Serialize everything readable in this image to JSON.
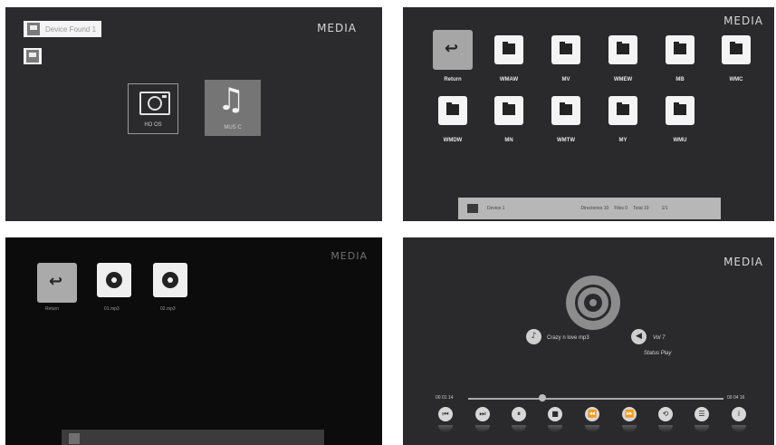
{
  "panel1": {
    "title": "MEDIA",
    "device_found": "Device Found 1",
    "tiles": [
      {
        "label": "HO OS"
      },
      {
        "label": "MUS C"
      }
    ]
  },
  "panel2": {
    "title": "MEDIA",
    "return_label": "Return",
    "folders_row1": [
      "WMAW",
      "MV",
      "WMEW",
      "MB",
      "WMC"
    ],
    "folders_row2": [
      "WMDW",
      "MN",
      "WMTW",
      "MY",
      "WMU"
    ],
    "status": {
      "device": "Device 1",
      "directories": "Directories 10",
      "files": "Files 0",
      "total": "Total 10",
      "page": "1/1"
    }
  },
  "panel3": {
    "title": "MEDIA",
    "items": [
      "Return",
      "01.mp3",
      "02.mp3"
    ]
  },
  "panel4": {
    "title": "MEDIA",
    "song": "Crazy n love mp3",
    "volume": "Vol 7",
    "status": "Status Play",
    "elapsed": "00 01 14",
    "duration": "00 04 16",
    "progress": 0.29
  }
}
